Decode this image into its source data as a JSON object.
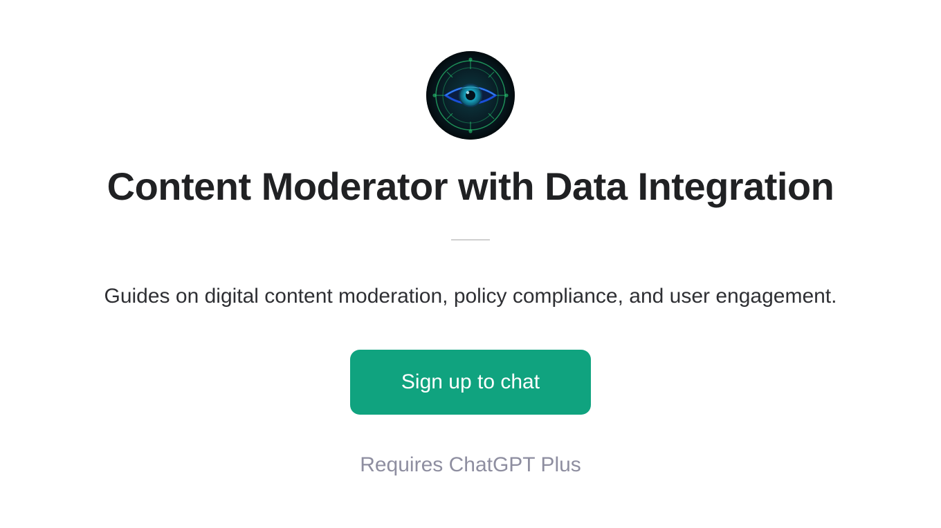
{
  "avatar": {
    "semantic": "eye-circuit-icon"
  },
  "title": "Content Moderator with Data Integration",
  "subtitle": "Guides on digital content moderation, policy compliance, and user engagement.",
  "cta": {
    "label": "Sign up to chat"
  },
  "requirement": "Requires ChatGPT Plus"
}
